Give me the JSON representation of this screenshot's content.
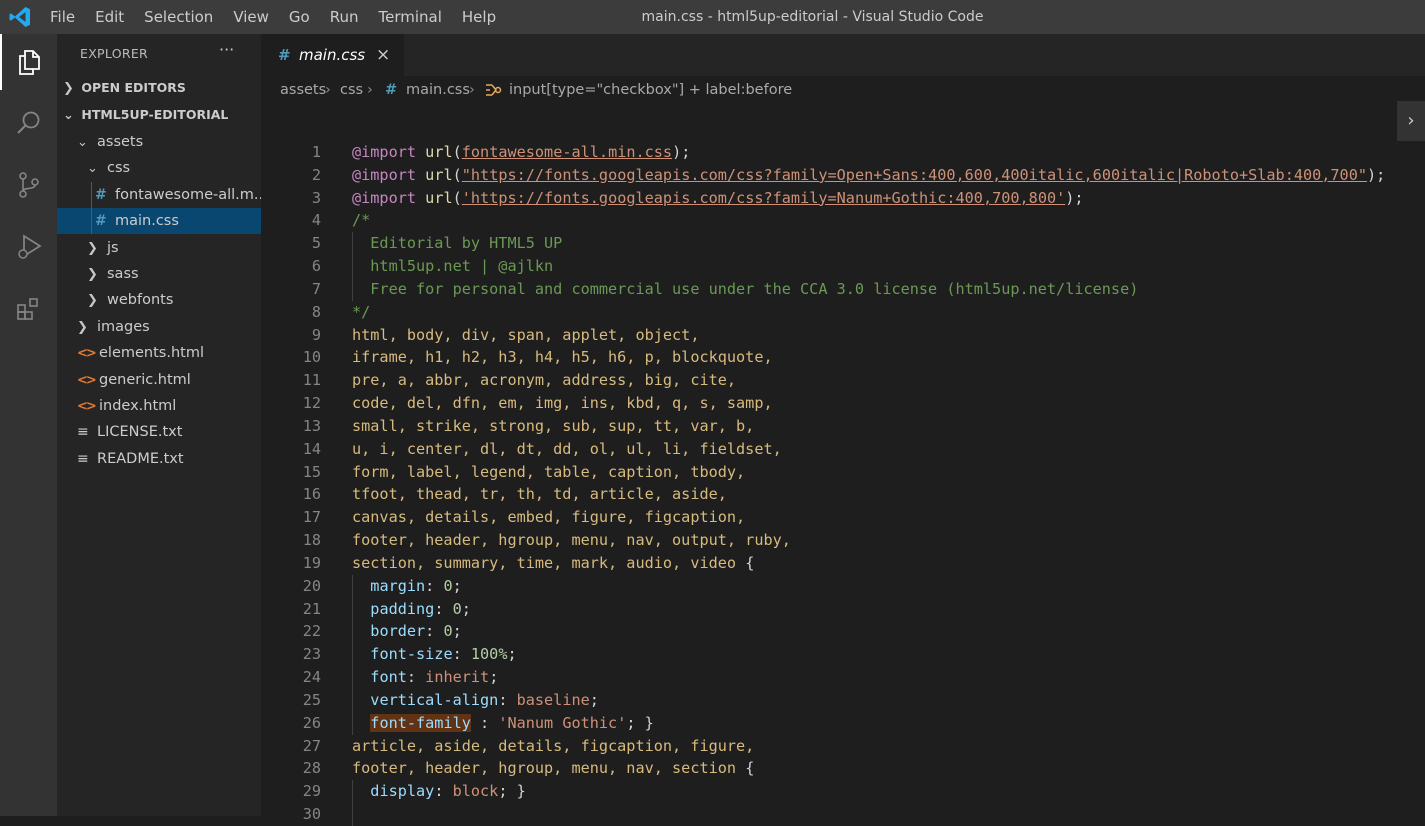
{
  "window": {
    "title": "main.css - html5up-editorial - Visual Studio Code"
  },
  "menu": [
    "File",
    "Edit",
    "Selection",
    "View",
    "Go",
    "Run",
    "Terminal",
    "Help"
  ],
  "activity_bar": [
    {
      "icon": "files-icon",
      "active": true
    },
    {
      "icon": "search-icon",
      "active": false
    },
    {
      "icon": "source-control-icon",
      "active": false
    },
    {
      "icon": "run-debug-icon",
      "active": false
    },
    {
      "icon": "extensions-icon",
      "active": false
    }
  ],
  "sidebar": {
    "header": "EXPLORER",
    "more": "···",
    "open_editors": "OPEN EDITORS",
    "project": "HTML5UP-EDITORIAL",
    "tree": [
      {
        "label": "assets",
        "type": "folder",
        "open": true,
        "indent": 1
      },
      {
        "label": "css",
        "type": "folder",
        "open": true,
        "indent": 2
      },
      {
        "label": "fontawesome-all.m...",
        "type": "css",
        "indent": 3
      },
      {
        "label": "main.css",
        "type": "css",
        "indent": 3,
        "selected": true
      },
      {
        "label": "js",
        "type": "folder",
        "open": false,
        "indent": 2
      },
      {
        "label": "sass",
        "type": "folder",
        "open": false,
        "indent": 2
      },
      {
        "label": "webfonts",
        "type": "folder",
        "open": false,
        "indent": 2
      },
      {
        "label": "images",
        "type": "folder",
        "open": false,
        "indent": 1
      },
      {
        "label": "elements.html",
        "type": "html",
        "indent": 1
      },
      {
        "label": "generic.html",
        "type": "html",
        "indent": 1
      },
      {
        "label": "index.html",
        "type": "html",
        "indent": 1
      },
      {
        "label": "LICENSE.txt",
        "type": "txt",
        "indent": 1
      },
      {
        "label": "README.txt",
        "type": "txt",
        "indent": 1
      }
    ]
  },
  "tab": {
    "label": "main.css",
    "close": "×"
  },
  "breadcrumb": [
    "assets",
    "css",
    "main.css",
    "input[type=\"checkbox\"] + label:before"
  ],
  "code_lines": [
    [
      {
        "t": "@import",
        "c": "kw"
      },
      {
        "t": " "
      },
      {
        "t": "url",
        "c": "fn"
      },
      {
        "t": "("
      },
      {
        "t": "fontawesome-all.min.css",
        "c": "str ul"
      },
      {
        "t": ");"
      }
    ],
    [
      {
        "t": "@import",
        "c": "kw"
      },
      {
        "t": " "
      },
      {
        "t": "url",
        "c": "fn"
      },
      {
        "t": "("
      },
      {
        "t": "\"https://fonts.googleapis.com/css?family=Open+Sans:400,600,400italic,600italic|Roboto+Slab:400,700\"",
        "c": "str ul"
      },
      {
        "t": ");"
      }
    ],
    [
      {
        "t": "@import",
        "c": "kw"
      },
      {
        "t": " "
      },
      {
        "t": "url",
        "c": "fn"
      },
      {
        "t": "("
      },
      {
        "t": "'https://fonts.googleapis.com/css?family=Nanum+Gothic:400,700,800'",
        "c": "str ul"
      },
      {
        "t": ");"
      }
    ],
    [
      {
        "t": "/*",
        "c": "cmt"
      }
    ],
    [
      {
        "t": "  Editorial by HTML5 UP",
        "c": "cmt"
      }
    ],
    [
      {
        "t": "  html5up.net | @ajlkn",
        "c": "cmt"
      }
    ],
    [
      {
        "t": "  Free for personal and commercial use under the CCA 3.0 license (html5up.net/license)",
        "c": "cmt"
      }
    ],
    [
      {
        "t": "*/",
        "c": "cmt"
      }
    ],
    [
      {
        "t": "html, body, div, span, applet, object,",
        "c": "sel"
      }
    ],
    [
      {
        "t": "iframe, h1, h2, h3, h4, h5, h6, p, blockquote,",
        "c": "sel"
      }
    ],
    [
      {
        "t": "pre, a, abbr, acronym, address, big, cite,",
        "c": "sel"
      }
    ],
    [
      {
        "t": "code, del, dfn, em, img, ins, kbd, q, s, samp,",
        "c": "sel"
      }
    ],
    [
      {
        "t": "small, strike, strong, sub, sup, tt, var, b,",
        "c": "sel"
      }
    ],
    [
      {
        "t": "u, i, center, dl, dt, dd, ol, ul, li, fieldset,",
        "c": "sel"
      }
    ],
    [
      {
        "t": "form, label, legend, table, caption, tbody,",
        "c": "sel"
      }
    ],
    [
      {
        "t": "tfoot, thead, tr, th, td, article, aside,",
        "c": "sel"
      }
    ],
    [
      {
        "t": "canvas, details, embed, figure, figcaption,",
        "c": "sel"
      }
    ],
    [
      {
        "t": "footer, header, hgroup, menu, nav, output, ruby,",
        "c": "sel"
      }
    ],
    [
      {
        "t": "section, summary, time, mark, audio, video",
        "c": "sel"
      },
      {
        "t": " {"
      }
    ],
    [
      {
        "t": "  "
      },
      {
        "t": "margin",
        "c": "prop"
      },
      {
        "t": ": "
      },
      {
        "t": "0",
        "c": "num-v"
      },
      {
        "t": ";"
      }
    ],
    [
      {
        "t": "  "
      },
      {
        "t": "padding",
        "c": "prop"
      },
      {
        "t": ": "
      },
      {
        "t": "0",
        "c": "num-v"
      },
      {
        "t": ";"
      }
    ],
    [
      {
        "t": "  "
      },
      {
        "t": "border",
        "c": "prop"
      },
      {
        "t": ": "
      },
      {
        "t": "0",
        "c": "num-v"
      },
      {
        "t": ";"
      }
    ],
    [
      {
        "t": "  "
      },
      {
        "t": "font-size",
        "c": "prop"
      },
      {
        "t": ": "
      },
      {
        "t": "100%",
        "c": "num-v"
      },
      {
        "t": ";"
      }
    ],
    [
      {
        "t": "  "
      },
      {
        "t": "font",
        "c": "prop"
      },
      {
        "t": ": "
      },
      {
        "t": "inherit",
        "c": "str"
      },
      {
        "t": ";"
      }
    ],
    [
      {
        "t": "  "
      },
      {
        "t": "vertical-align",
        "c": "prop"
      },
      {
        "t": ": "
      },
      {
        "t": "baseline",
        "c": "str"
      },
      {
        "t": ";"
      }
    ],
    [
      {
        "t": "  "
      },
      {
        "t": "font-family",
        "c": "prop hl"
      },
      {
        "t": " : "
      },
      {
        "t": "'Nanum Gothic'",
        "c": "str"
      },
      {
        "t": "; }"
      }
    ],
    [
      {
        "t": "article, aside, details, figcaption, figure,",
        "c": "sel"
      }
    ],
    [
      {
        "t": "footer, header, hgroup, menu, nav, section",
        "c": "sel"
      },
      {
        "t": " {"
      }
    ],
    [
      {
        "t": "  "
      },
      {
        "t": "display",
        "c": "prop"
      },
      {
        "t": ": "
      },
      {
        "t": "block",
        "c": "str"
      },
      {
        "t": "; }"
      }
    ],
    [
      {
        "t": ""
      }
    ]
  ]
}
